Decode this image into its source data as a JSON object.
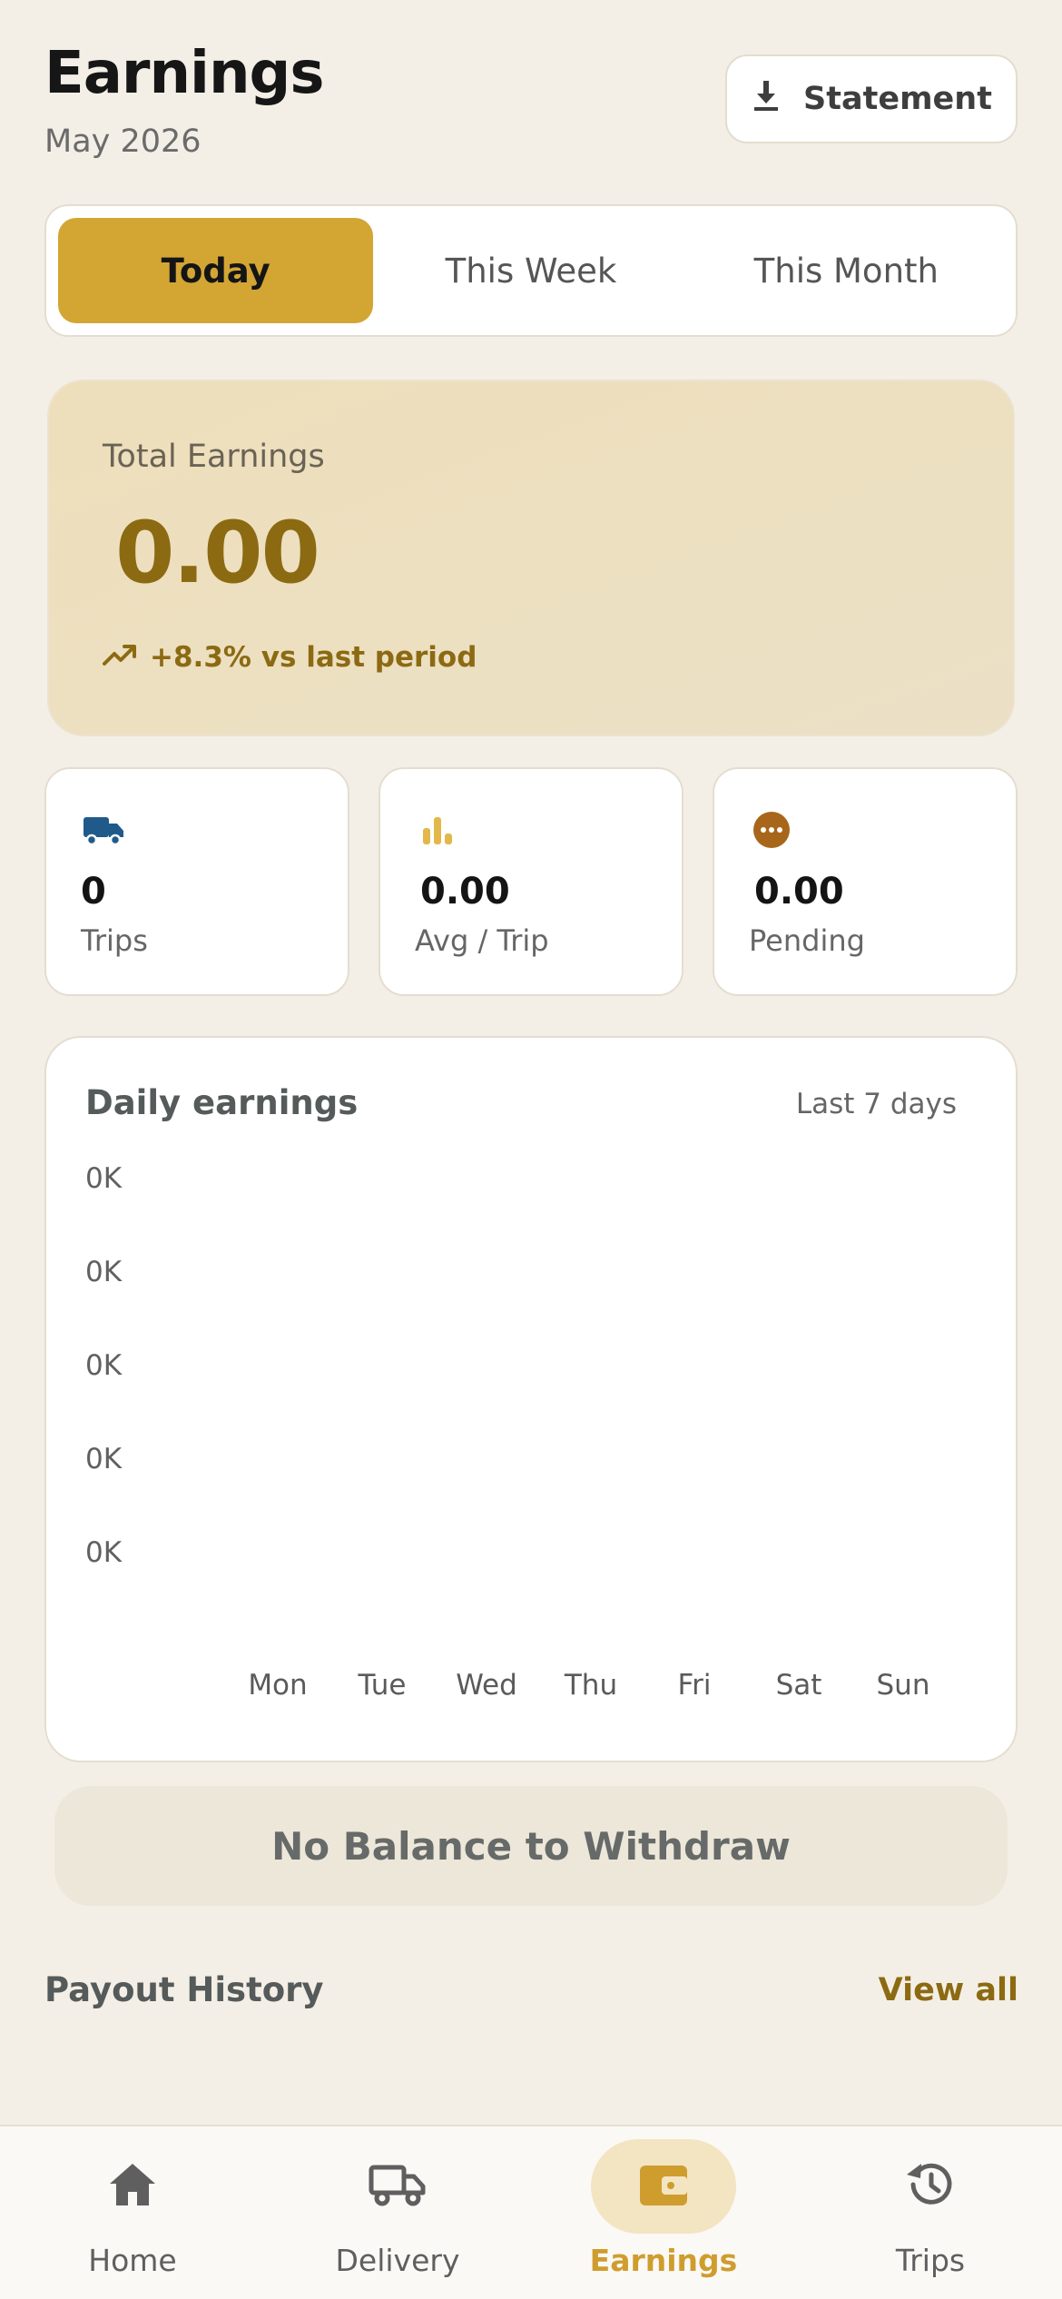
{
  "header": {
    "title": "Earnings",
    "subtitle": "May 2026",
    "statement_label": "Statement",
    "statement_icon": "download-icon"
  },
  "period_tabs": [
    {
      "label": "Today",
      "active": true
    },
    {
      "label": "This Week",
      "active": false
    },
    {
      "label": "This Month",
      "active": false
    }
  ],
  "total": {
    "label": "Total Earnings",
    "value": "0.00",
    "trend_text": "+8.3% vs last period",
    "trend_icon": "trending-up-icon"
  },
  "stats": [
    {
      "icon": "truck-icon",
      "value": "0",
      "label": "Trips",
      "color": "#1f5a8a"
    },
    {
      "icon": "bar-chart-icon",
      "value": "0.00",
      "label": "Avg / Trip",
      "color": "#e2b84a"
    },
    {
      "icon": "more-circle-icon",
      "value": "0.00",
      "label": "Pending",
      "color": "#a8661a"
    }
  ],
  "chart": {
    "title": "Daily earnings",
    "range_label": "Last 7 days"
  },
  "chart_data": {
    "type": "bar",
    "categories": [
      "Mon",
      "Tue",
      "Wed",
      "Thu",
      "Fri",
      "Sat",
      "Sun"
    ],
    "values": [
      0,
      0,
      0,
      0,
      0,
      0,
      0
    ],
    "yticks": [
      "0K",
      "0K",
      "0K",
      "0K",
      "0K"
    ],
    "title": "Daily earnings",
    "xlabel": "",
    "ylabel": "",
    "grid": false
  },
  "withdraw": {
    "label": "No Balance to Withdraw",
    "enabled": false
  },
  "payout": {
    "title": "Payout History",
    "view_all": "View all"
  },
  "nav": [
    {
      "label": "Home",
      "icon": "home-icon",
      "active": false
    },
    {
      "label": "Delivery",
      "icon": "truck-icon",
      "active": false
    },
    {
      "label": "Earnings",
      "icon": "wallet-icon",
      "active": true
    },
    {
      "label": "Trips",
      "icon": "history-icon",
      "active": false
    }
  ],
  "colors": {
    "accent": "#d3a533",
    "accent_dark": "#8c6a12",
    "background": "#f4efe6"
  }
}
